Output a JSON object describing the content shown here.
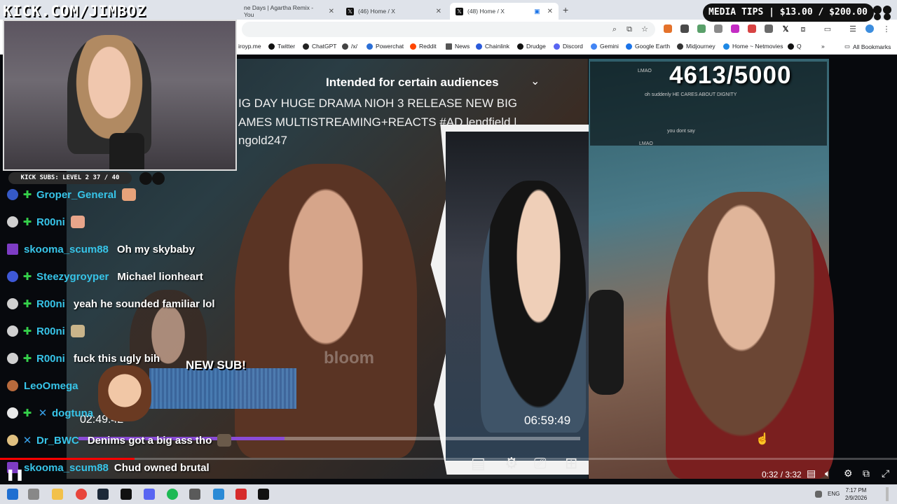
{
  "stream_overlay": {
    "url_text": "KICK.COM/JIMBOZ",
    "media_tips": "MEDIA TIPS | $13.00 / $200.00",
    "kick_subs": "KICK SUBS: LEVEL 2 37 / 40",
    "new_sub": "NEW SUB!"
  },
  "tabs": [
    {
      "label": "ne Days | Agartha Remix - You"
    },
    {
      "label": "(46) Home / X"
    },
    {
      "label": "(48) Home / X"
    }
  ],
  "bookmarks": [
    {
      "label": "iroyp.me"
    },
    {
      "label": "Twitter"
    },
    {
      "label": "ChatGPT"
    },
    {
      "label": "/x/"
    },
    {
      "label": "Powerchat"
    },
    {
      "label": "Reddit"
    },
    {
      "label": "News"
    },
    {
      "label": "Chainlink"
    },
    {
      "label": "Drudge"
    },
    {
      "label": "Discord"
    },
    {
      "label": "Gemini"
    },
    {
      "label": "Google Earth"
    },
    {
      "label": "Midjourney"
    },
    {
      "label": "Home ~ Netmovies"
    },
    {
      "label": "Q"
    }
  ],
  "all_bookmarks": "All Bookmarks",
  "video": {
    "audience": "Intended for certain audiences",
    "title_lines": [
      "IG DAY HUGE DRAMA NIOH 3 RELEASE NEW BIG",
      "AMES MULTISTREAMING+REACTS #AD lendfield |",
      "ngold247"
    ],
    "watermark": "bloom",
    "elapsed": "02:49:42",
    "duration": "06:59:49",
    "inner_progress": 0.41,
    "counter": "4613/5000",
    "overlay_chat": [
      {
        "user": "",
        "msg": "",
        "extra": "LMAO"
      },
      {
        "user": "",
        "msg": "oh suddenly HE CARES ABOUT DIGNITY"
      },
      {
        "user": "",
        "msg": ""
      },
      {
        "user": "",
        "msg": ""
      },
      {
        "user": "",
        "msg": ""
      },
      {
        "user": "",
        "msg": "you dont say"
      },
      {
        "user": "",
        "msg": "LMAO"
      }
    ]
  },
  "chat": [
    {
      "user": "Groper_General",
      "msg": ""
    },
    {
      "user": "R00ni",
      "msg": ""
    },
    {
      "user": "skooma_scum88",
      "msg": "Oh my skybaby"
    },
    {
      "user": "Steezygroyper",
      "msg": "Michael lionheart"
    },
    {
      "user": "R00ni",
      "msg": "yeah he sounded familiar lol"
    },
    {
      "user": "R00ni",
      "msg": ""
    },
    {
      "user": "R00ni",
      "msg": "fuck this ugly bih"
    },
    {
      "user": "LeoOmega",
      "msg": ""
    },
    {
      "user": "dogtuna",
      "msg": ""
    },
    {
      "user": "Dr_BWC",
      "msg": "Denims got a big ass tho"
    },
    {
      "user": "skooma_scum88",
      "msg": "Chud owned brutal"
    }
  ],
  "player": {
    "time": "0:32 / 3:32",
    "progress": 0.15
  },
  "taskbar": {
    "lang": "ENG",
    "time": "7:17 PM",
    "date": "2/9/2026"
  },
  "colors": {
    "chat_user": "#37c4e8",
    "gem": "#35d04a",
    "progress_red": "#ff0000",
    "inner_progress": "#8a4bd6"
  }
}
